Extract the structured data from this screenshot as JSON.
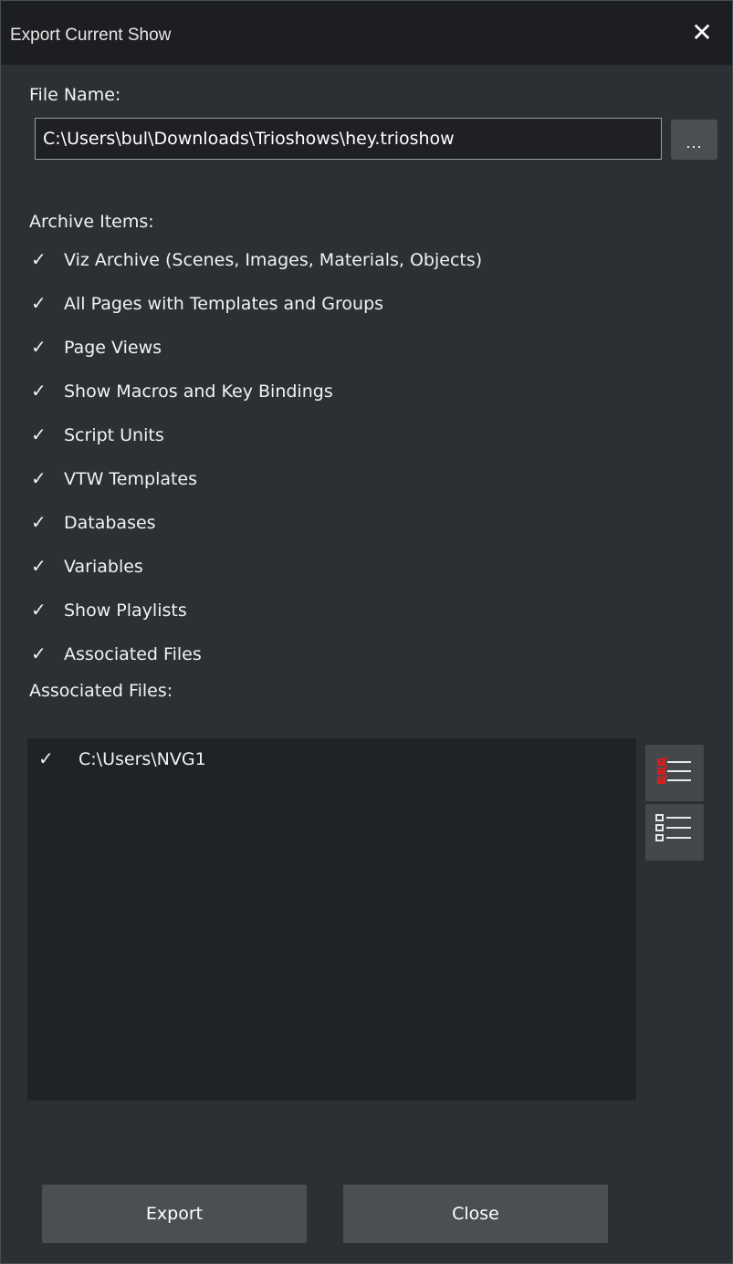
{
  "window": {
    "title": "Export Current Show"
  },
  "file": {
    "label": "File Name:",
    "value": "C:\\Users\\bul\\Downloads\\Trioshows\\hey.trioshow",
    "browse_label": "..."
  },
  "archive": {
    "label": "Archive Items:",
    "items": [
      {
        "label": "Viz Archive (Scenes, Images, Materials, Objects)",
        "checked": true
      },
      {
        "label": "All Pages with Templates and Groups",
        "checked": true
      },
      {
        "label": "Page Views",
        "checked": true
      },
      {
        "label": "Show Macros and Key Bindings",
        "checked": true
      },
      {
        "label": "Script Units",
        "checked": true
      },
      {
        "label": "VTW Templates",
        "checked": true
      },
      {
        "label": "Databases",
        "checked": true
      },
      {
        "label": "Variables",
        "checked": true
      },
      {
        "label": "Show Playlists",
        "checked": true
      },
      {
        "label": "Associated Files",
        "checked": true
      }
    ]
  },
  "associated": {
    "label": "Associated Files:",
    "files": [
      {
        "path": "C:\\Users\\NVG1",
        "checked": true
      }
    ]
  },
  "buttons": {
    "export": "Export",
    "close": "Close"
  },
  "colors": {
    "check_accent": "#d42020"
  }
}
